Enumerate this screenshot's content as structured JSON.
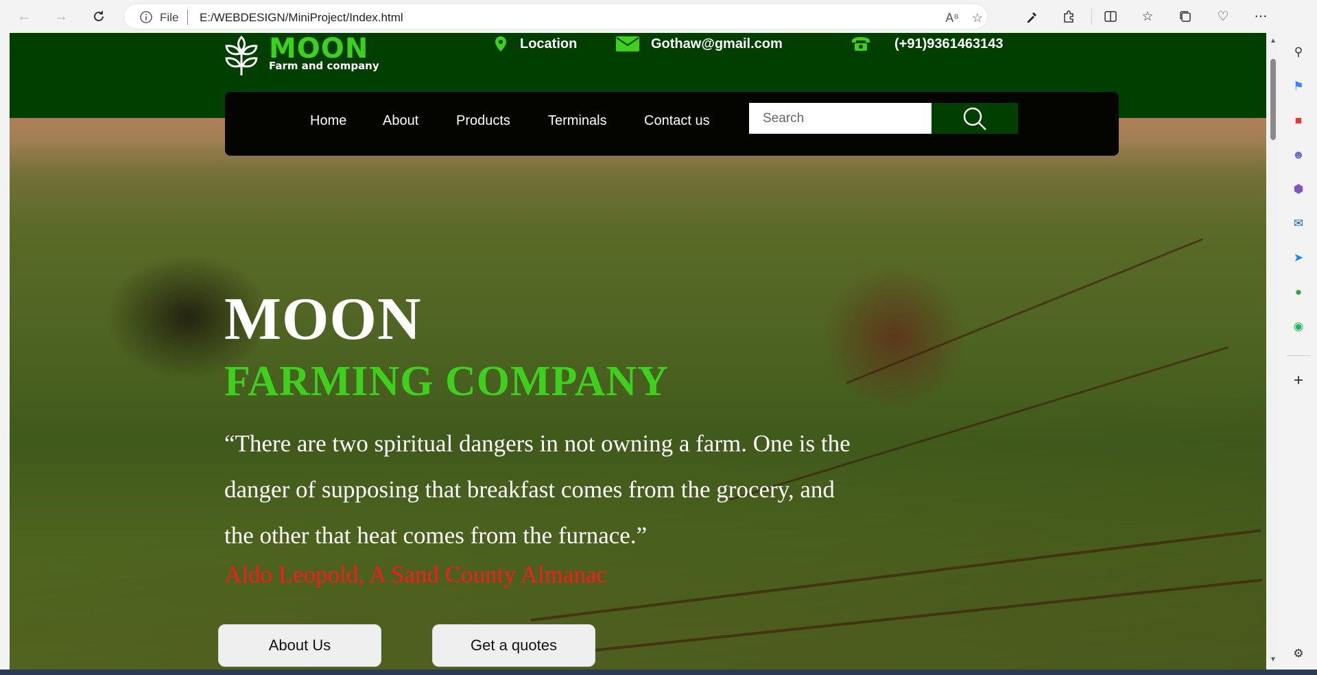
{
  "browser": {
    "file_label": "File",
    "url": "E:/WEBDESIGN/MiniProject/Index.html"
  },
  "header": {
    "logo_name": "MOON",
    "logo_sub": "Farm and company",
    "location": "Location",
    "email": "Gothaw@gmail.com",
    "phone": "(+91)9361463143"
  },
  "nav": {
    "items": [
      "Home",
      "About",
      "Products",
      "Terminals",
      "Contact us"
    ],
    "search_placeholder": "Search"
  },
  "hero": {
    "title": "MOON",
    "subtitle": "FARMING COMPANY",
    "quote": "“There are two spiritual dangers in not owning a farm. One is the danger of supposing that breakfast comes from the grocery, and the other that heat comes from the furnace.”",
    "author": "Aldo Leopold, A Sand County Almanac",
    "button_about": "About Us",
    "button_quote": "Get a quotes"
  },
  "colors": {
    "accent_green": "#3dd11e",
    "dark_green": "#013f00",
    "nav_bg": "#050500",
    "author_red": "#ff1a1a"
  }
}
